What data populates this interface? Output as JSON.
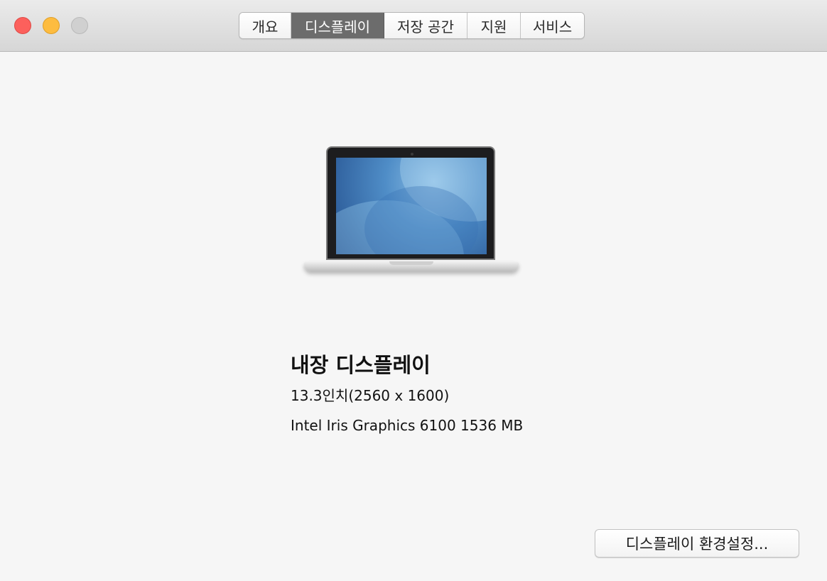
{
  "window": {
    "controls": [
      {
        "name": "close-button",
        "color": "#fc605c"
      },
      {
        "name": "minimize-button",
        "color": "#fdbc40"
      },
      {
        "name": "zoom-button",
        "color": "#d0d0d0"
      }
    ]
  },
  "tabs": [
    {
      "label": "개요",
      "active": false
    },
    {
      "label": "디스플레이",
      "active": true
    },
    {
      "label": "저장 공간",
      "active": false
    },
    {
      "label": "지원",
      "active": false
    },
    {
      "label": "서비스",
      "active": false
    }
  ],
  "display": {
    "illustration_icon": "macbook-laptop-icon",
    "title": "내장 디스플레이",
    "size_resolution": "13.3인치(2560 x 1600)",
    "graphics": "Intel Iris Graphics 6100 1536 MB"
  },
  "actions": {
    "preferences_button": "디스플레이 환경설정..."
  },
  "colors": {
    "active_tab": "#6c6c6c",
    "background": "#f6f6f6"
  }
}
